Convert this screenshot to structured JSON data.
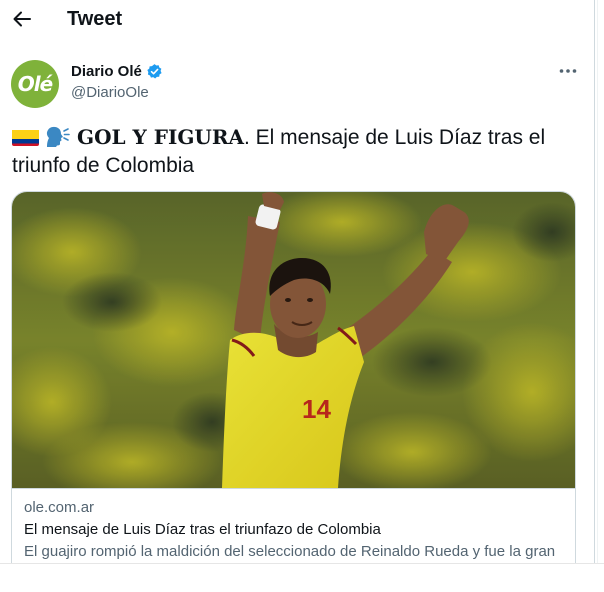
{
  "header": {
    "title": "Tweet",
    "back_icon": "arrow-left-icon"
  },
  "author": {
    "avatar_text": "Olé",
    "avatar_color": "#7fb23a",
    "display_name": "Diario Olé",
    "handle": "@DiarioOle",
    "verified_color": "#1d9bf0"
  },
  "tweet": {
    "emoji_flag": "colombia-flag-icon",
    "emoji_speaking": "speaking-head-icon",
    "bold_text": "GOL Y FIGURA",
    "text_line1": ". El mensaje de Luis Díaz tras el",
    "text_line2": "triunfo de Colombia"
  },
  "card": {
    "domain": "ole.com.ar",
    "title": "El mensaje de Luis Díaz tras el triunfazo de Colombia",
    "description": "El guajiro rompió la maldición del seleccionado de Reinaldo Rueda y fue la gran",
    "jersey_number": "14"
  },
  "colors": {
    "text_primary": "#0f1419",
    "text_secondary": "#536471",
    "border": "#cfd9de",
    "accent": "#1d9bf0"
  }
}
